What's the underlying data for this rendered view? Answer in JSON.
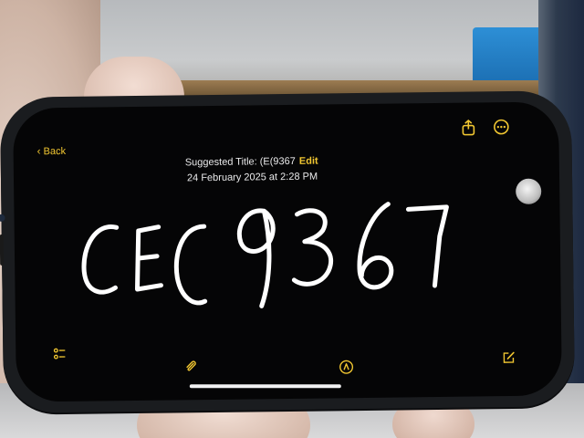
{
  "note": {
    "back_label": "Back",
    "suggested_title_label": "Suggested Title: (E(9367",
    "edit_label": "Edit",
    "date": "24 February 2025 at 2:28 PM",
    "handwritten_text": "CEC9367"
  },
  "icons": {
    "back": "chevron-left-icon",
    "share": "share-icon",
    "more": "more-icon",
    "checklist": "checklist-icon",
    "attach": "paperclip-icon",
    "markup": "markup-pen-icon",
    "compose": "compose-icon"
  },
  "colors": {
    "accent": "#f1c631",
    "screen": "#050506",
    "ink": "#ffffff"
  }
}
